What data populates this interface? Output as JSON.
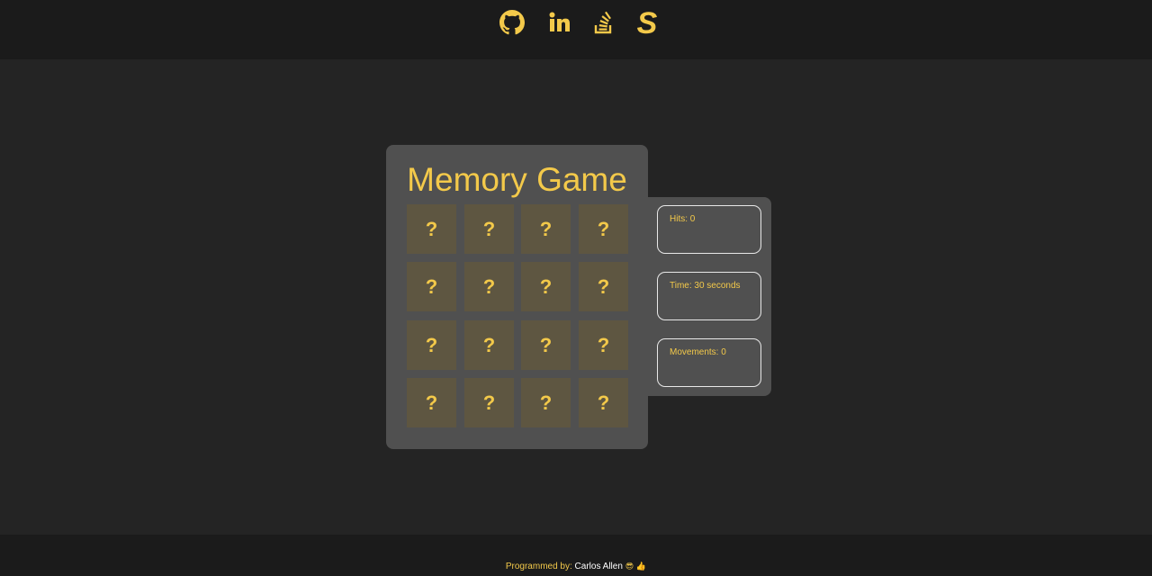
{
  "header": {
    "links": [
      {
        "icon": "github-icon",
        "name": "github-link"
      },
      {
        "icon": "linkedin-icon",
        "name": "linkedin-link"
      },
      {
        "icon": "stackoverflow-icon",
        "name": "stackoverflow-link"
      },
      {
        "icon": "s-logo-icon",
        "name": "s-logo-link"
      }
    ]
  },
  "game": {
    "title": "Memory Game",
    "card_face": "?",
    "rows": 4,
    "columns": 4
  },
  "stats": {
    "hits": "Hits: 0",
    "time": "Time: 30 seconds",
    "movements": "Movements: 0"
  },
  "footer": {
    "prefix": "Programmed by:",
    "author": "Carlos Allen",
    "emoji": "😎 👍"
  },
  "colors": {
    "accent": "#f3c94a",
    "background": "#242424",
    "bar": "#1b1b1b",
    "panel": "#505050",
    "card": "#5e5641"
  }
}
